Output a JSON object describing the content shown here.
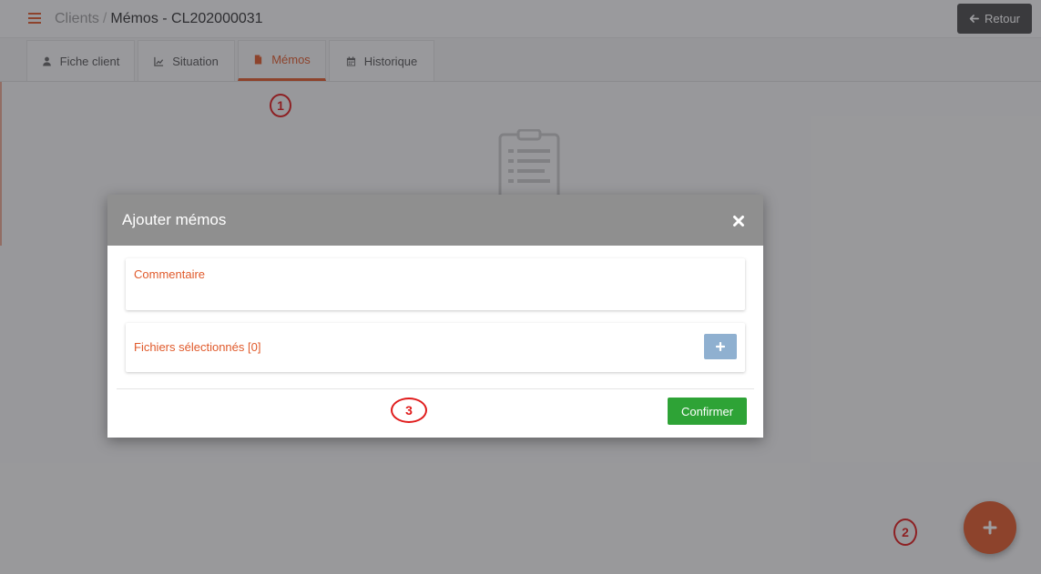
{
  "header": {
    "breadcrumb_parent": "Clients",
    "breadcrumb_separator": "/",
    "page_title": "Mémos - CL202000031",
    "back_label": "Retour"
  },
  "tabs": [
    {
      "label": "Fiche client",
      "icon": "user-icon",
      "active": false
    },
    {
      "label": "Situation",
      "icon": "chart-icon",
      "active": false
    },
    {
      "label": "Mémos",
      "icon": "document-icon",
      "active": true
    },
    {
      "label": "Historique",
      "icon": "calendar-icon",
      "active": false
    }
  ],
  "annotations": [
    "1",
    "2",
    "3"
  ],
  "modal": {
    "title": "Ajouter mémos",
    "comment_label": "Commentaire",
    "comment_value": "",
    "files_label": "Fichiers sélectionnés [0]",
    "confirm_label": "Confirmer"
  },
  "colors": {
    "accent": "#e05a2b",
    "confirm": "#2ea336",
    "modal_header": "#8f8f8f",
    "annotation": "#e01b1b",
    "add_file_button": "#8fb0d0"
  }
}
